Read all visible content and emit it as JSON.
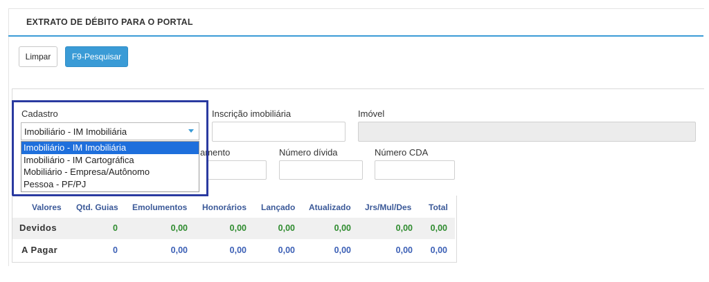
{
  "page": {
    "title": "EXTRATO DE DÉBITO PARA O PORTAL"
  },
  "toolbar": {
    "clear_label": "Limpar",
    "search_label": "F9-Pesquisar"
  },
  "form": {
    "cadastro_label": "Cadastro",
    "cadastro_value": "Imobiliário - IM Imobiliária",
    "cadastro_options": [
      "Imobiliário - IM Imobiliária",
      "Imobiliário - IM Cartográfica",
      "Mobiliário - Empresa/Autônomo",
      "Pessoa - PF/PJ"
    ],
    "inscricao_label": "Inscrição imobiliária",
    "imovel_label": "Imóvel",
    "lancamento_label_partial": "amento",
    "numero_divida_label": "Número dívida",
    "numero_cda_label": "Número CDA"
  },
  "summary_table": {
    "headers": [
      "Valores",
      "Qtd. Guias",
      "Emolumentos",
      "Honorários",
      "Lançado",
      "Atualizado",
      "Jrs/Mul/Des",
      "Total"
    ],
    "rows": [
      {
        "label": "Devidos",
        "values": [
          "0",
          "0,00",
          "0,00",
          "0,00",
          "0,00",
          "0,00",
          "0,00"
        ]
      },
      {
        "label": "A Pagar",
        "values": [
          "0",
          "0,00",
          "0,00",
          "0,00",
          "0,00",
          "0,00",
          "0,00"
        ]
      }
    ]
  },
  "colors": {
    "accent": "#3a9bd6",
    "highlight_border": "#2a3aa0",
    "selected_option": "#1e6fdc",
    "header_text": "#3b5998",
    "devidos_values": "#2e8b2e",
    "apagar_values": "#3b5fb5"
  }
}
